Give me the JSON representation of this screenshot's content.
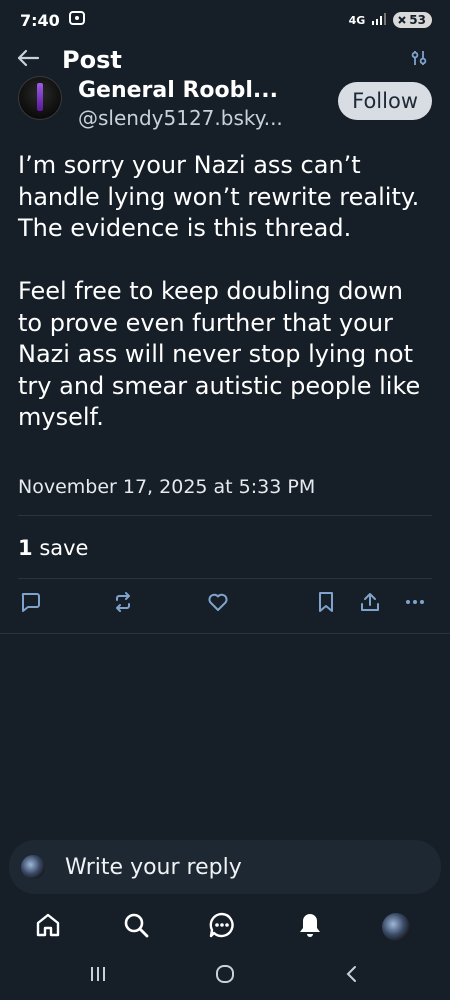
{
  "status_bar": {
    "time": "7:40",
    "network": "4G",
    "battery": "53",
    "colors": {
      "battery_bg": "#d9d9d9"
    }
  },
  "header": {
    "title": "Post",
    "back_icon": "arrow-left-icon",
    "filter_icon": "sliders-icon"
  },
  "post": {
    "author": {
      "display_name": "General Roobl...",
      "handle": "@slendy5127.bsky..."
    },
    "follow_label": "Follow",
    "paragraphs": [
      "I’m sorry your Nazi ass can’t handle lying won’t rewrite reality. The evidence is this thread.",
      "Feel free to keep doubling down to prove even further that your Nazi ass will never stop lying not try and smear autistic people like myself."
    ],
    "timestamp": "November 17, 2025 at 5:33 PM",
    "saves_count": "1",
    "saves_label": "save",
    "actions": [
      "reply-icon",
      "repost-icon",
      "like-icon",
      "bookmark-icon",
      "share-icon",
      "more-icon"
    ]
  },
  "reply_box": {
    "placeholder": "Write your reply"
  },
  "bottom_nav": {
    "items": [
      "home-icon",
      "search-icon",
      "chat-icon",
      "notifications-icon",
      "profile-avatar"
    ]
  },
  "colors": {
    "background": "#161e27",
    "divider": "#2a3441",
    "follow_bg": "#d8dde3",
    "icon": "#7fa3cc"
  }
}
